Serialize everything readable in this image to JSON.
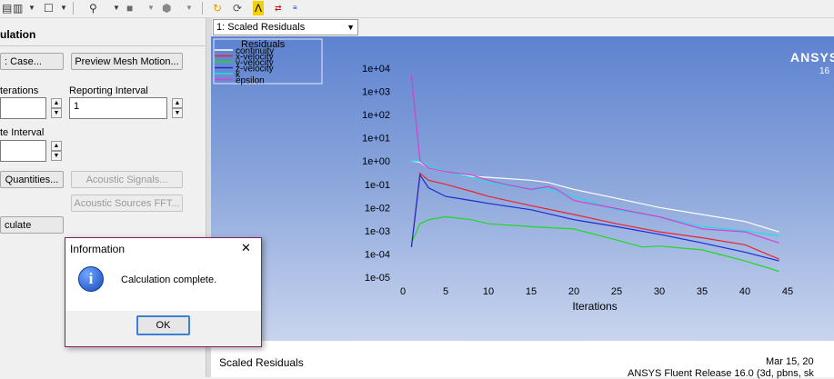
{
  "toolbar": {
    "scaled_residuals_dropdown": "1: Scaled Residuals"
  },
  "left_panel": {
    "title": "ulation",
    "case_button": ": Case...",
    "preview_mesh_button": "Preview Mesh Motion...",
    "iterations_label": "terations",
    "iterations_value": "",
    "reporting_interval_label": "Reporting Interval",
    "reporting_interval_value": "1",
    "update_interval_label": "te Interval",
    "update_interval_value": "",
    "quantities_button": "Quantities...",
    "acoustic_signals_button": "Acoustic Signals...",
    "acoustic_sources_button": "Acoustic Sources FFT...",
    "calculate_button": "culate"
  },
  "dialog": {
    "title": "Information",
    "close": "✕",
    "message": "Calculation complete.",
    "ok": "OK",
    "info_glyph": "i"
  },
  "graphics": {
    "brand": "ANSYS",
    "brand_sub": "16",
    "footer_left": "Scaled Residuals",
    "footer_right1": "Mar 15, 20",
    "footer_right2": "ANSYS Fluent Release 16.0 (3d, pbns, sk"
  },
  "chart_data": {
    "type": "line",
    "xlabel": "Iterations",
    "ylabel": "",
    "xlim": [
      0,
      45
    ],
    "ylim_log10": [
      -5,
      4
    ],
    "y_scale": "log",
    "x_ticks": [
      0,
      5,
      10,
      15,
      20,
      25,
      30,
      35,
      40,
      45
    ],
    "y_ticks": [
      "1e-05",
      "1e-04",
      "1e-03",
      "1e-02",
      "1e-01",
      "1e+00",
      "1e+01",
      "1e+02",
      "1e+03",
      "1e+04"
    ],
    "legend_title": "Residuals",
    "legend_placement": "top-left",
    "series": [
      {
        "name": "continuity",
        "color": "#ffffff",
        "x": [
          1,
          2,
          3,
          5,
          8,
          10,
          15,
          17,
          20,
          25,
          30,
          35,
          40,
          44
        ],
        "y": [
          1.0,
          0.9,
          0.5,
          0.35,
          0.22,
          0.2,
          0.15,
          0.12,
          0.06,
          0.025,
          0.01,
          0.005,
          0.0025,
          0.0009
        ]
      },
      {
        "name": "x-velocity",
        "color": "#e8242d",
        "x": [
          1,
          2,
          3,
          5,
          8,
          10,
          15,
          20,
          25,
          30,
          35,
          40,
          44
        ],
        "y": [
          0.0002,
          0.3,
          0.15,
          0.1,
          0.05,
          0.03,
          0.012,
          0.005,
          0.002,
          0.0009,
          0.0005,
          0.00025,
          6e-05
        ]
      },
      {
        "name": "y-velocity",
        "color": "#1fd81f",
        "x": [
          1,
          2,
          3,
          5,
          8,
          10,
          15,
          20,
          25,
          28,
          30,
          35,
          40,
          44
        ],
        "y": [
          0.0003,
          0.002,
          0.003,
          0.004,
          0.003,
          0.002,
          0.0015,
          0.0012,
          0.0004,
          0.0002,
          0.00022,
          0.00015,
          5e-05,
          1.8e-05
        ]
      },
      {
        "name": "z-velocity",
        "color": "#1a2bd4",
        "x": [
          1,
          2,
          3,
          5,
          8,
          10,
          15,
          20,
          25,
          30,
          35,
          40,
          44
        ],
        "y": [
          0.0002,
          0.25,
          0.07,
          0.03,
          0.02,
          0.015,
          0.008,
          0.003,
          0.0015,
          0.0007,
          0.0003,
          0.00012,
          5e-05
        ]
      },
      {
        "name": "k",
        "color": "#22dce0",
        "x": [
          1,
          2,
          3,
          5,
          8,
          10,
          15,
          17,
          20,
          25,
          30,
          35,
          40,
          44
        ],
        "y": [
          1.0,
          1.0,
          0.7,
          0.35,
          0.2,
          0.12,
          0.06,
          0.06,
          0.03,
          0.008,
          0.004,
          0.0015,
          0.001,
          0.0006
        ]
      },
      {
        "name": "epsilon",
        "color": "#d63fd0",
        "x": [
          1,
          2,
          3,
          5,
          8,
          10,
          12,
          15,
          17,
          18,
          20,
          25,
          30,
          35,
          40,
          44
        ],
        "y": [
          5000,
          1.0,
          0.5,
          0.35,
          0.25,
          0.15,
          0.1,
          0.06,
          0.08,
          0.06,
          0.02,
          0.009,
          0.004,
          0.0012,
          0.0009,
          0.0003
        ]
      }
    ]
  }
}
